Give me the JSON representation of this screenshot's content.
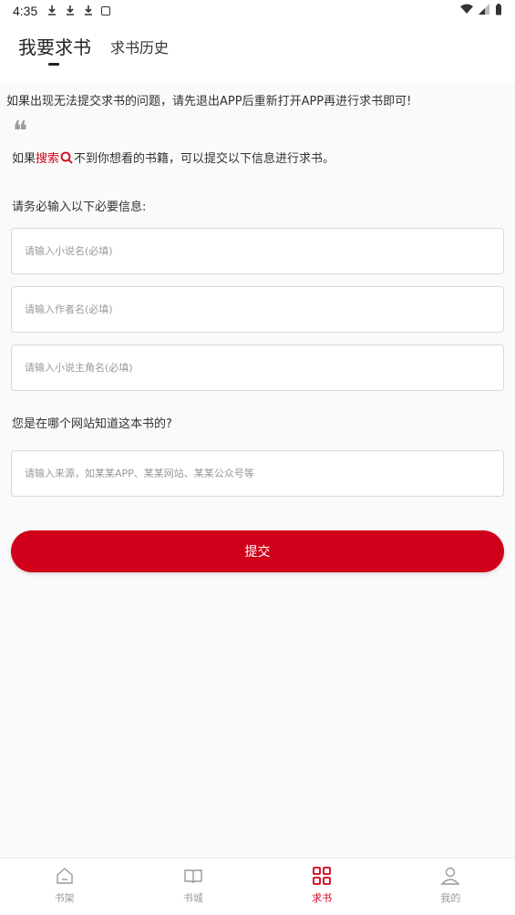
{
  "status_bar": {
    "time": "4:35",
    "download_icons": [
      "download-icon",
      "download-icon",
      "download-icon"
    ],
    "app_icon": "app-icon",
    "wifi_icon": "wifi-icon",
    "signal_icon": "signal-icon",
    "battery_icon": "battery-icon"
  },
  "header": {
    "active_tab": "我要求书",
    "history_tab": "求书历史"
  },
  "notice": "如果出现无法提交求书的问题，请先退出APP后重新打开APP再进行求书即可!",
  "hint": {
    "prefix": "如果",
    "accent": "搜索",
    "suffix": "不到你想看的书籍，可以提交以下信息进行求书。"
  },
  "form": {
    "required_label": "请务必输入以下必要信息:",
    "novel_name_placeholder": "请输入小说名(必填)",
    "author_placeholder": "请输入作者名(必填)",
    "protagonist_placeholder": "请输入小说主角名(必填)",
    "question": "您是在哪个网站知道这本书的?",
    "source_placeholder": "请输入来源，如某某APP、某某网站、某某公众号等",
    "submit_label": "提交"
  },
  "bottom_nav": {
    "items": [
      {
        "label": "书架",
        "icon": "bookshelf-icon",
        "active": false
      },
      {
        "label": "书城",
        "icon": "book-store-icon",
        "active": false
      },
      {
        "label": "求书",
        "icon": "request-book-icon",
        "active": true
      },
      {
        "label": "我的",
        "icon": "profile-icon",
        "active": false
      }
    ]
  },
  "colors": {
    "accent": "#d0021b",
    "background": "#fafafa"
  }
}
